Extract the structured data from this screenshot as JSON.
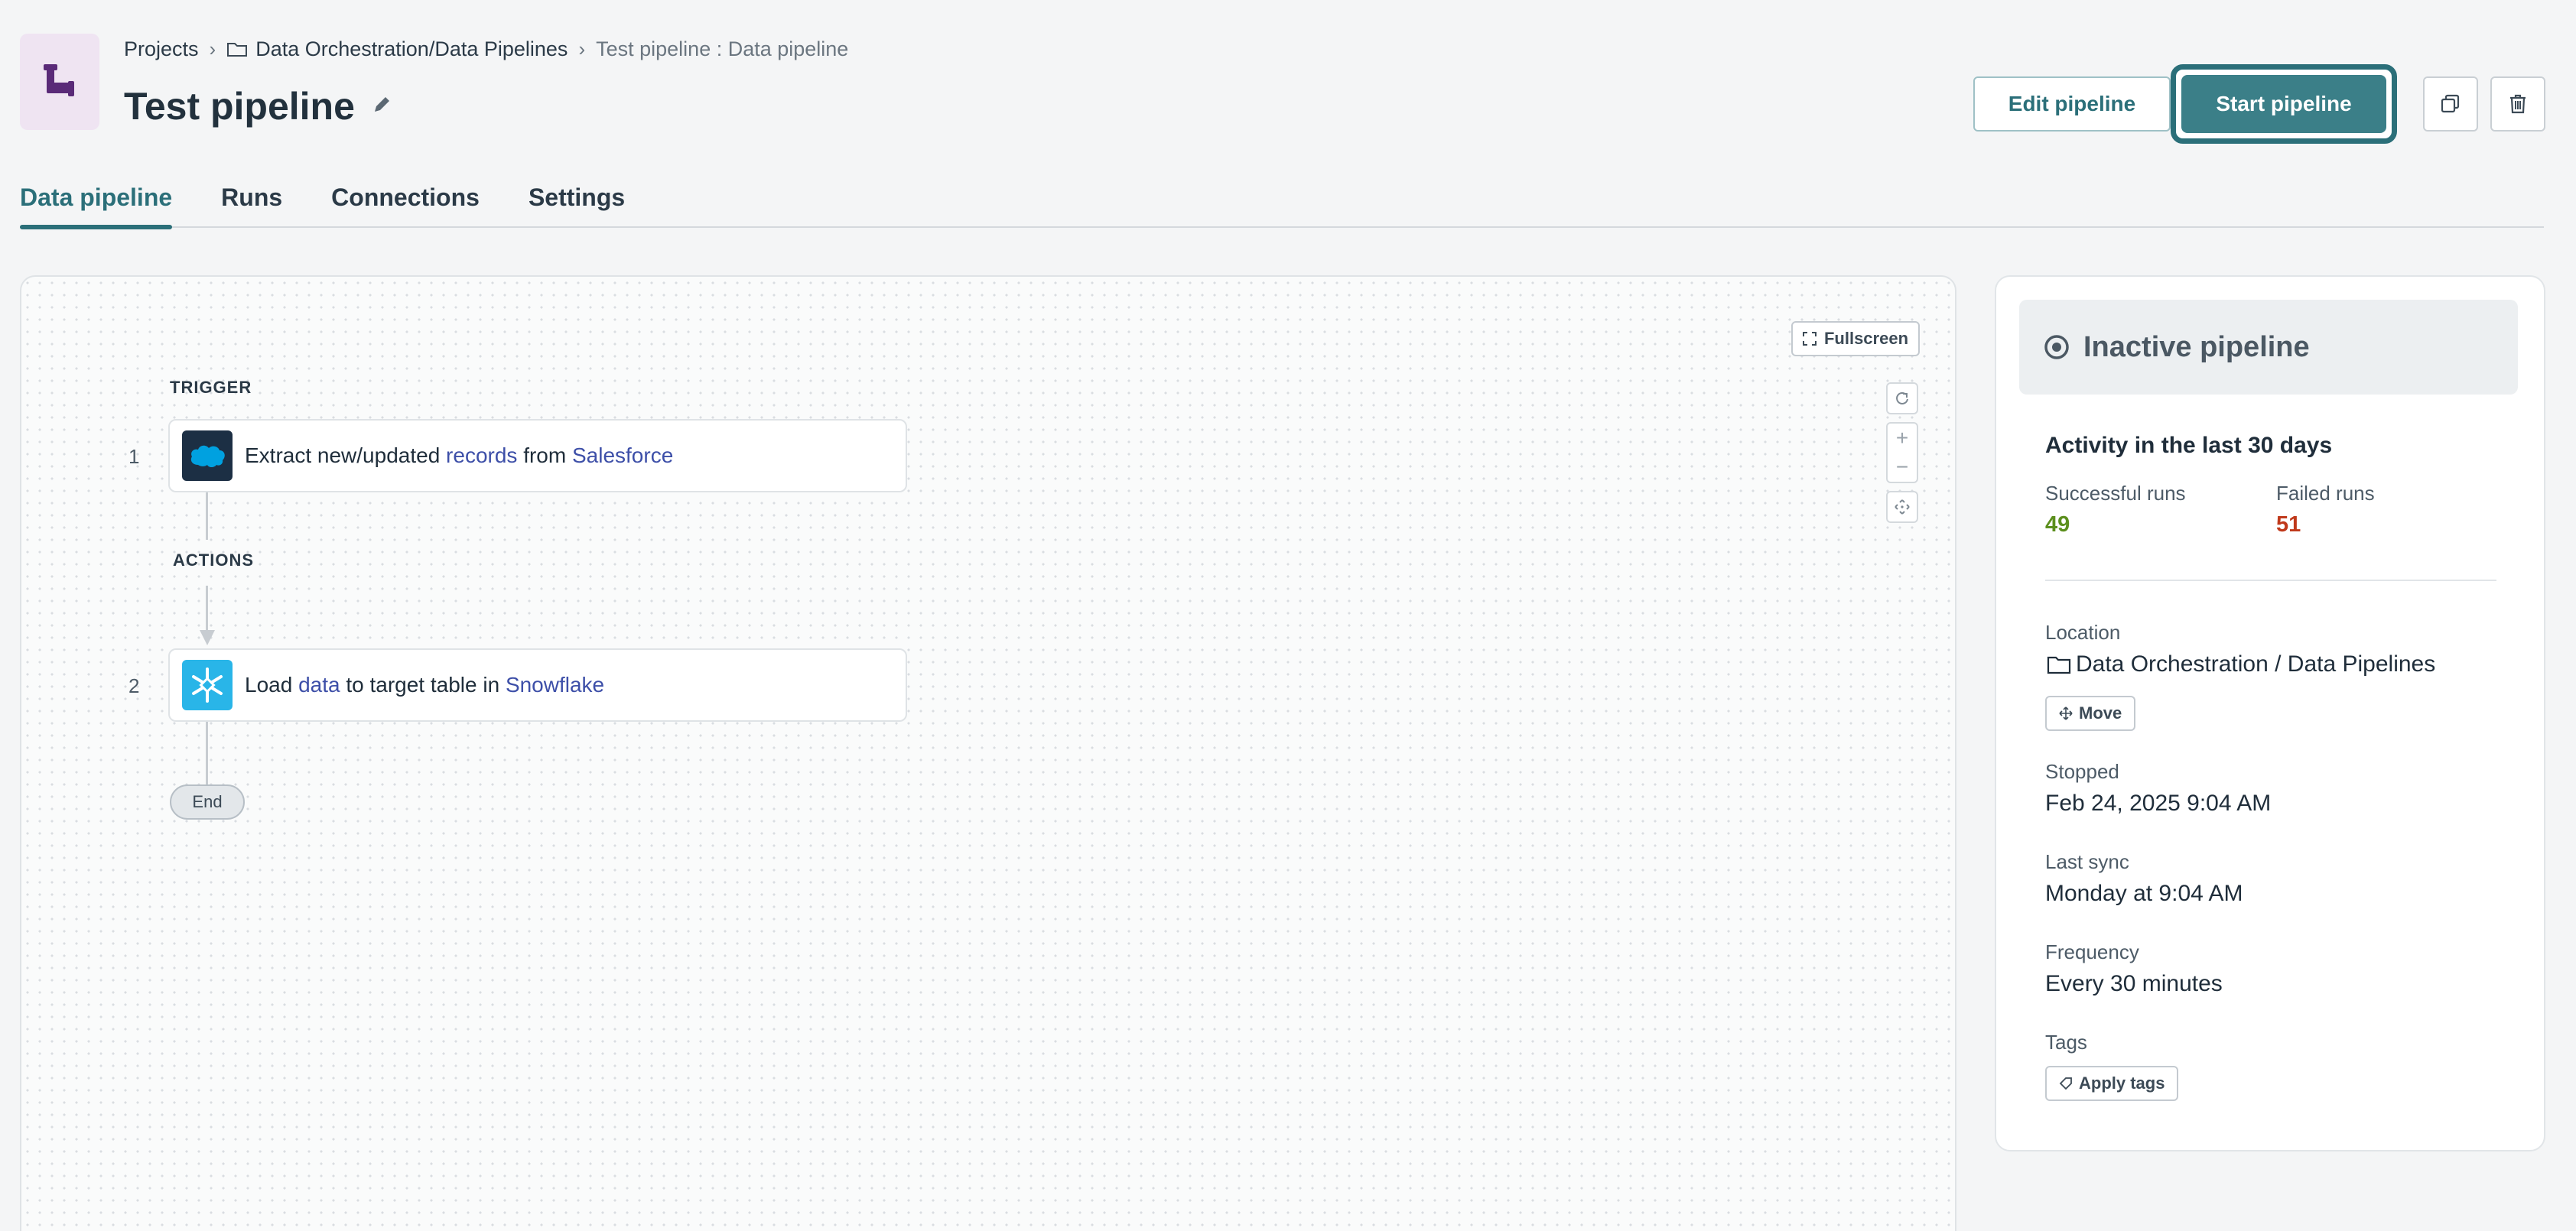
{
  "breadcrumb": {
    "projects": "Projects",
    "folder": "Data Orchestration/Data Pipelines",
    "current": "Test pipeline : Data pipeline"
  },
  "header": {
    "title": "Test pipeline",
    "edit_label": "Edit pipeline",
    "start_label": "Start pipeline"
  },
  "tabs": [
    {
      "label": "Data pipeline",
      "active": true
    },
    {
      "label": "Runs"
    },
    {
      "label": "Connections"
    },
    {
      "label": "Settings"
    }
  ],
  "canvas": {
    "fullscreen_label": "Fullscreen",
    "trigger_label": "TRIGGER",
    "actions_label": "ACTIONS",
    "end_label": "End",
    "steps": [
      {
        "number": "1",
        "pre": "Extract new/updated ",
        "hl1": "records",
        "mid": " from ",
        "hl2": "Salesforce",
        "logo": "salesforce-logo"
      },
      {
        "number": "2",
        "pre": "Load ",
        "hl1": "data",
        "mid": " to target table in ",
        "hl2": "Snowflake",
        "logo": "snowflake-logo"
      }
    ]
  },
  "panel": {
    "status": "Inactive pipeline",
    "activity_title": "Activity in the last 30 days",
    "successful_label": "Successful runs",
    "successful_value": "49",
    "failed_label": "Failed runs",
    "failed_value": "51",
    "location_label": "Location",
    "location_value": "Data Orchestration / Data Pipelines",
    "move_label": "Move",
    "stopped_label": "Stopped",
    "stopped_value": "Feb 24, 2025 9:04 AM",
    "last_sync_label": "Last sync",
    "last_sync_value": "Monday at 9:04 AM",
    "frequency_label": "Frequency",
    "frequency_value": "Every 30 minutes",
    "tags_label": "Tags",
    "apply_tags_label": "Apply tags"
  },
  "colors": {
    "accent": "#2b6f79",
    "success": "#5c8f1e",
    "failure": "#c0391b",
    "link": "#3d4fa8"
  }
}
